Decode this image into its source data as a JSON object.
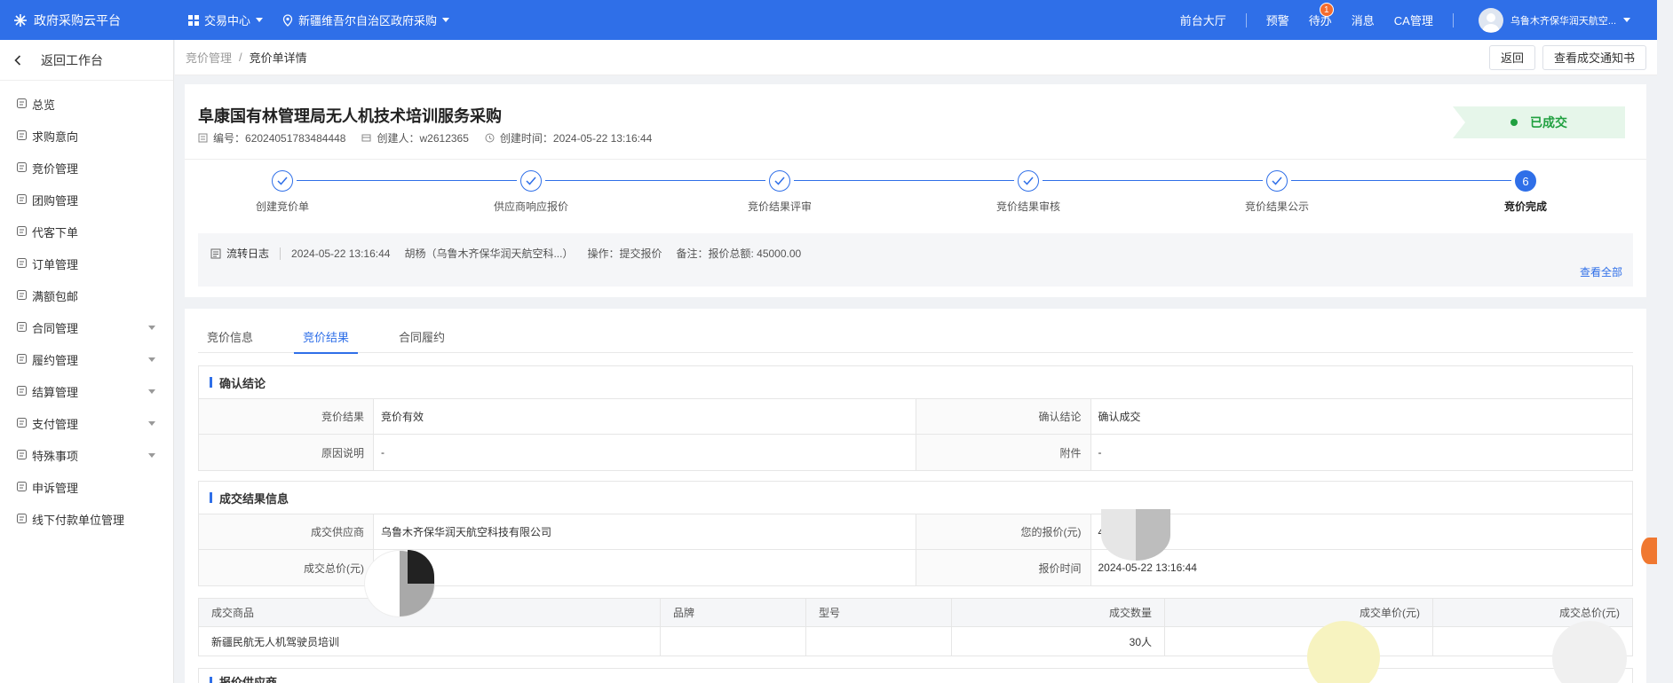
{
  "topbar": {
    "brand": "政府采购云平台",
    "trade_center": "交易中心",
    "region": "新疆维吾尔自治区政府采购",
    "links": [
      "前台大厅",
      "预警",
      "待办",
      "消息",
      "CA管理"
    ],
    "badge_count": "1",
    "user_name": "乌鲁木齐保华润天航空..."
  },
  "sidebar": {
    "back_label": "返回工作台",
    "items": [
      {
        "label": "总览",
        "icon": "home-icon",
        "expand": false
      },
      {
        "label": "求购意向",
        "icon": "doc-icon",
        "expand": false
      },
      {
        "label": "竞价管理",
        "icon": "auction-icon",
        "expand": false
      },
      {
        "label": "团购管理",
        "icon": "group-icon",
        "expand": false
      },
      {
        "label": "代客下单",
        "icon": "order-icon",
        "expand": false
      },
      {
        "label": "订单管理",
        "icon": "list-icon",
        "expand": false
      },
      {
        "label": "满额包邮",
        "icon": "package-icon",
        "expand": false
      },
      {
        "label": "合同管理",
        "icon": "contract-icon",
        "expand": true
      },
      {
        "label": "履约管理",
        "icon": "perform-icon",
        "expand": true
      },
      {
        "label": "结算管理",
        "icon": "settle-icon",
        "expand": true
      },
      {
        "label": "支付管理",
        "icon": "pay-icon",
        "expand": true
      },
      {
        "label": "特殊事项",
        "icon": "special-icon",
        "expand": true
      },
      {
        "label": "申诉管理",
        "icon": "appeal-icon",
        "expand": false
      },
      {
        "label": "线下付款单位管理",
        "icon": "offline-icon",
        "expand": false
      }
    ]
  },
  "breadcrumb": {
    "parent": "竞价管理",
    "current": "竞价单详情",
    "back_button": "返回",
    "notice_button": "查看成交通知书"
  },
  "header": {
    "title": "阜康国有林管理局无人机技术培训服务采购",
    "number_label": "编号：",
    "number": "62024051783484448",
    "creator_label": "创建人：",
    "creator": "w2612365",
    "created_label": "创建时间：",
    "created": "2024-05-22 13:16:44",
    "status": "已成交"
  },
  "steps": [
    {
      "label": "创建竞价单",
      "done": true
    },
    {
      "label": "供应商响应报价",
      "done": true
    },
    {
      "label": "竞价结果评审",
      "done": true
    },
    {
      "label": "竞价结果审核",
      "done": true
    },
    {
      "label": "竞价结果公示",
      "done": true
    },
    {
      "label": "竞价完成",
      "done": false,
      "number": "6"
    }
  ],
  "log": {
    "label": "流转日志",
    "time": "2024-05-22 13:16:44",
    "operator": "胡杨（乌鲁木齐保华润天航空科...）",
    "action": "操作：提交报价",
    "remark": "备注：报价总额: 45000.00",
    "view_all": "查看全部"
  },
  "tabs": [
    "竞价信息",
    "竞价结果",
    "合同履约"
  ],
  "active_tab": 1,
  "confirm": {
    "title": "确认结论",
    "rows": [
      [
        {
          "k": "竞价结果",
          "v": "竞价有效"
        },
        {
          "k": "确认结论",
          "v": "确认成交"
        }
      ],
      [
        {
          "k": "原因说明",
          "v": "-"
        },
        {
          "k": "附件",
          "v": "-"
        }
      ]
    ]
  },
  "deal": {
    "title": "成交结果信息",
    "rows": [
      [
        {
          "k": "成交供应商",
          "v": "乌鲁木齐保华润天航空科技有限公司"
        },
        {
          "k": "您的报价(元)",
          "v": "4"
        }
      ],
      [
        {
          "k": "成交总价(元)",
          "v": ""
        },
        {
          "k": "报价时间",
          "v": "2024-05-22 13:16:44"
        }
      ]
    ]
  },
  "goods": {
    "headers": [
      "成交商品",
      "品牌",
      "型号",
      "成交数量",
      "成交单价(元)",
      "成交总价(元)"
    ],
    "rows": [
      [
        "新疆民航无人机驾驶员培训",
        "",
        "",
        "30人",
        "",
        ""
      ]
    ]
  },
  "quote_section": "报价供应商"
}
